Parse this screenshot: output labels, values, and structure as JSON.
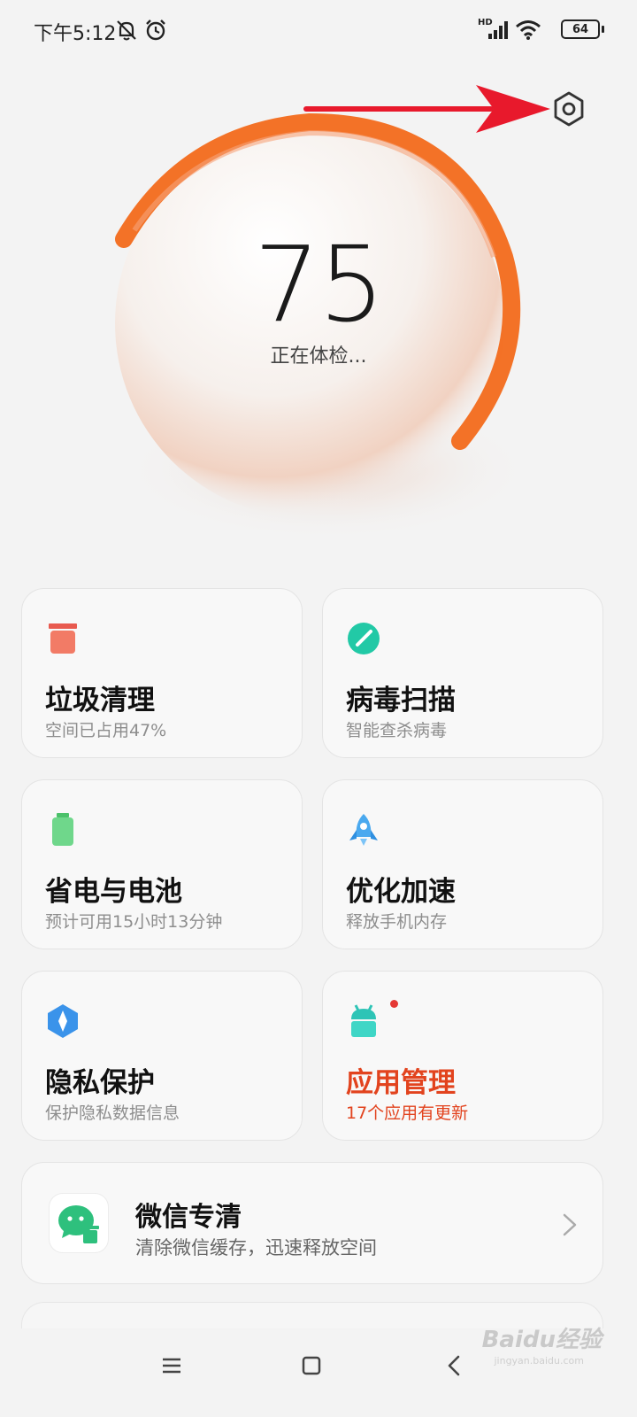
{
  "status_bar": {
    "time": "下午5:12",
    "network": "HD",
    "battery": "64"
  },
  "score": {
    "value": "75",
    "status": "正在体检..."
  },
  "colors": {
    "ring": "#f26a1b",
    "arrow": "#e8192c",
    "alert": "#e2431e"
  },
  "cards": [
    {
      "title": "垃圾清理",
      "subtitle": "空间已占用47%",
      "icon": "trash-icon"
    },
    {
      "title": "病毒扫描",
      "subtitle": "智能查杀病毒",
      "icon": "shield-scan-icon"
    },
    {
      "title": "省电与电池",
      "subtitle": "预计可用15小时13分钟",
      "icon": "battery-icon"
    },
    {
      "title": "优化加速",
      "subtitle": "释放手机内存",
      "icon": "rocket-icon"
    },
    {
      "title": "隐私保护",
      "subtitle": "保护隐私数据信息",
      "icon": "privacy-icon"
    },
    {
      "title": "应用管理",
      "subtitle": "17个应用有更新",
      "icon": "android-icon"
    }
  ],
  "wechat": {
    "title": "微信专清",
    "subtitle": "清除微信缓存，迅速释放空间",
    "icon": "wechat-clean-icon"
  },
  "watermark": {
    "brand": "Baidu经验",
    "url": "jingyan.baidu.com"
  }
}
